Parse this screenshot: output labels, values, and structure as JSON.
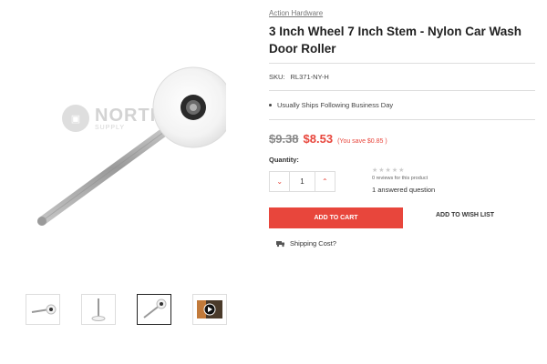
{
  "product": {
    "brand": "Action Hardware",
    "title": "3 Inch Wheel 7 Inch Stem - Nylon Car Wash Door Roller",
    "sku_label": "SKU:",
    "sku_value": "RL371-NY-H",
    "ship_note": "Usually Ships Following Business Day",
    "old_price": "$9.38",
    "new_price": "$8.53",
    "save_text": "(You save $0.85 )",
    "quantity_label": "Quantity:",
    "quantity_value": "1",
    "review_text": "0 reviews for this product",
    "answered_text": "1 answered question",
    "star_rating": 0,
    "add_to_cart": "ADD TO CART",
    "add_to_wishlist": "ADD TO WISH LIST",
    "shipping_cost": "Shipping Cost?"
  },
  "watermark": {
    "text": "NORTH S",
    "sub": "SUPPLY"
  },
  "colors": {
    "accent": "#e8463c",
    "muted": "#888888"
  },
  "thumbnails": [
    {
      "icon": "roller-angled-icon"
    },
    {
      "icon": "roller-vertical-icon"
    },
    {
      "icon": "roller-diagonal-icon"
    },
    {
      "icon": "video-play-icon"
    }
  ]
}
